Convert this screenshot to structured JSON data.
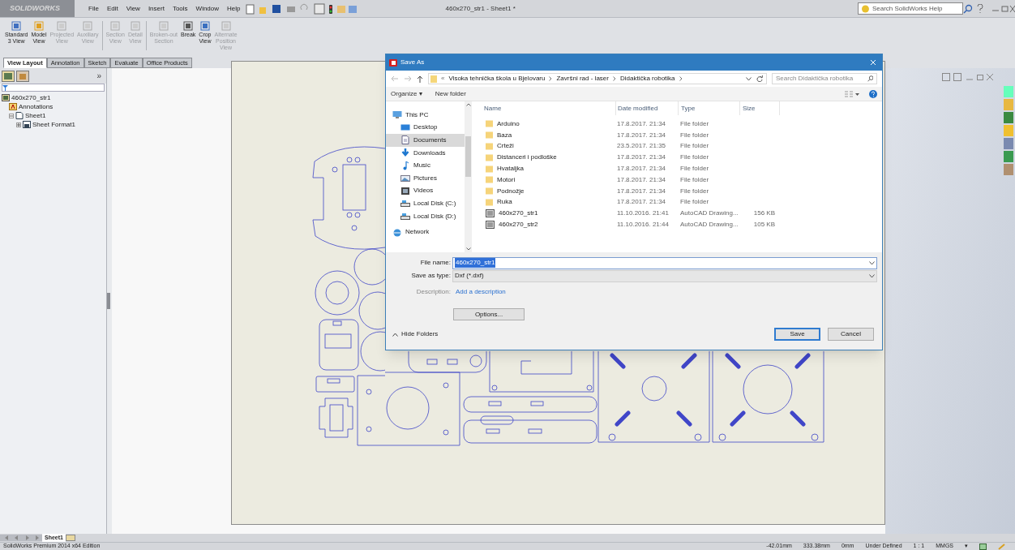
{
  "title_bar": {
    "logo": "SOLIDWORKS",
    "menu": [
      "File",
      "Edit",
      "View",
      "Insert",
      "Tools",
      "Window",
      "Help"
    ],
    "document_title": "460x270_str1 - Sheet1 *",
    "search_placeholder": "Search SolidWorks Help"
  },
  "ribbon": [
    {
      "lines": [
        "Standard",
        "3 View"
      ],
      "disabled": false
    },
    {
      "lines": [
        "Model",
        "View"
      ],
      "disabled": false
    },
    {
      "lines": [
        "Projected",
        "View"
      ],
      "disabled": true
    },
    {
      "lines": [
        "Auxiliary",
        "View"
      ],
      "disabled": true
    },
    {
      "lines": [
        "Section",
        "View"
      ],
      "disabled": true
    },
    {
      "lines": [
        "Detail",
        "View"
      ],
      "disabled": true
    },
    {
      "lines": [
        "Broken-out",
        "Section"
      ],
      "disabled": true
    },
    {
      "lines": [
        "Break"
      ],
      "disabled": false
    },
    {
      "lines": [
        "Crop",
        "View"
      ],
      "disabled": false
    },
    {
      "lines": [
        "Alternate",
        "Position",
        "View"
      ],
      "disabled": true
    }
  ],
  "tabs": [
    {
      "label": "View Layout",
      "selected": true
    },
    {
      "label": "Annotation",
      "selected": false
    },
    {
      "label": "Sketch",
      "selected": false
    },
    {
      "label": "Evaluate",
      "selected": false
    },
    {
      "label": "Office Products",
      "selected": false
    }
  ],
  "panel_expand": "»",
  "feature_tree": [
    {
      "label": "460x270_str1",
      "kind": "drawing",
      "children": [
        {
          "label": "Annotations",
          "kind": "annotations"
        },
        {
          "label": "Sheet1",
          "kind": "sheet",
          "expanded": true,
          "children": [
            {
              "label": "Sheet Format1",
              "kind": "format",
              "expanded": false
            }
          ]
        }
      ]
    }
  ],
  "dialog": {
    "title": "Save As",
    "breadcrumb_lead": "«",
    "breadcrumb": [
      "Visoka tehnička škola u Bjelovaru",
      "Završni rad - laser",
      "Didaktička robotika"
    ],
    "search_placeholder": "Search Didaktička robotika",
    "organize": "Organize ▾",
    "new_folder": "New folder",
    "nav": [
      {
        "label": "This PC",
        "kind": "pc",
        "selected": false
      },
      {
        "label": "Desktop",
        "kind": "desktop",
        "selected": false
      },
      {
        "label": "Documents",
        "kind": "documents",
        "selected": true
      },
      {
        "label": "Downloads",
        "kind": "downloads",
        "selected": false
      },
      {
        "label": "Music",
        "kind": "music",
        "selected": false
      },
      {
        "label": "Pictures",
        "kind": "pictures",
        "selected": false
      },
      {
        "label": "Videos",
        "kind": "videos",
        "selected": false
      },
      {
        "label": "Local Disk (C:)",
        "kind": "disk",
        "selected": false
      },
      {
        "label": "Local Disk (D:)",
        "kind": "disk",
        "selected": false
      },
      {
        "label": "Network",
        "kind": "network",
        "selected": false
      }
    ],
    "columns": [
      "Name",
      "Date modified",
      "Type",
      "Size"
    ],
    "rows": [
      {
        "name": "Arduino",
        "date": "17.8.2017. 21:34",
        "type": "File folder",
        "kind": "folder"
      },
      {
        "name": "Baza",
        "date": "17.8.2017. 21:34",
        "type": "File folder",
        "kind": "folder"
      },
      {
        "name": "Crteži",
        "date": "23.5.2017. 21:35",
        "type": "File folder",
        "kind": "folder"
      },
      {
        "name": "Distanceri i podloške",
        "date": "17.8.2017. 21:34",
        "type": "File folder",
        "kind": "folder"
      },
      {
        "name": "Hvataljka",
        "date": "17.8.2017. 21:34",
        "type": "File folder",
        "kind": "folder"
      },
      {
        "name": "Motori",
        "date": "17.8.2017. 21:34",
        "type": "File folder",
        "kind": "folder"
      },
      {
        "name": "Podnožje",
        "date": "17.8.2017. 21:34",
        "type": "File folder",
        "kind": "folder"
      },
      {
        "name": "Ruka",
        "date": "17.8.2017. 21:34",
        "type": "File folder",
        "kind": "folder"
      },
      {
        "name": "460x270_str1",
        "date": "11.10.2016. 21:41",
        "type": "AutoCAD Drawing...",
        "size": "156 KB",
        "kind": "file"
      },
      {
        "name": "460x270_str2",
        "date": "11.10.2016. 21:44",
        "type": "AutoCAD Drawing...",
        "size": "105 KB",
        "kind": "file"
      }
    ],
    "file_name_label": "File name:",
    "file_name": "460x270_str1",
    "type_label": "Save as type:",
    "save_type": "Dxf (*.dxf)",
    "description_label": "Description:",
    "description_link": "Add a description",
    "options": "Options...",
    "hide_folders": "Hide Folders",
    "save": "Save",
    "cancel": "Cancel"
  },
  "sheet_tabs": [
    {
      "label": "Sheet1",
      "selected": true
    }
  ],
  "status_bar": {
    "edition": "SolidWorks Premium 2014 x64 Edition",
    "readings": [
      "-42.01mm",
      "333.38mm",
      "0mm",
      "Under Defined",
      "1 : 1",
      "MMGS",
      "▾"
    ]
  }
}
